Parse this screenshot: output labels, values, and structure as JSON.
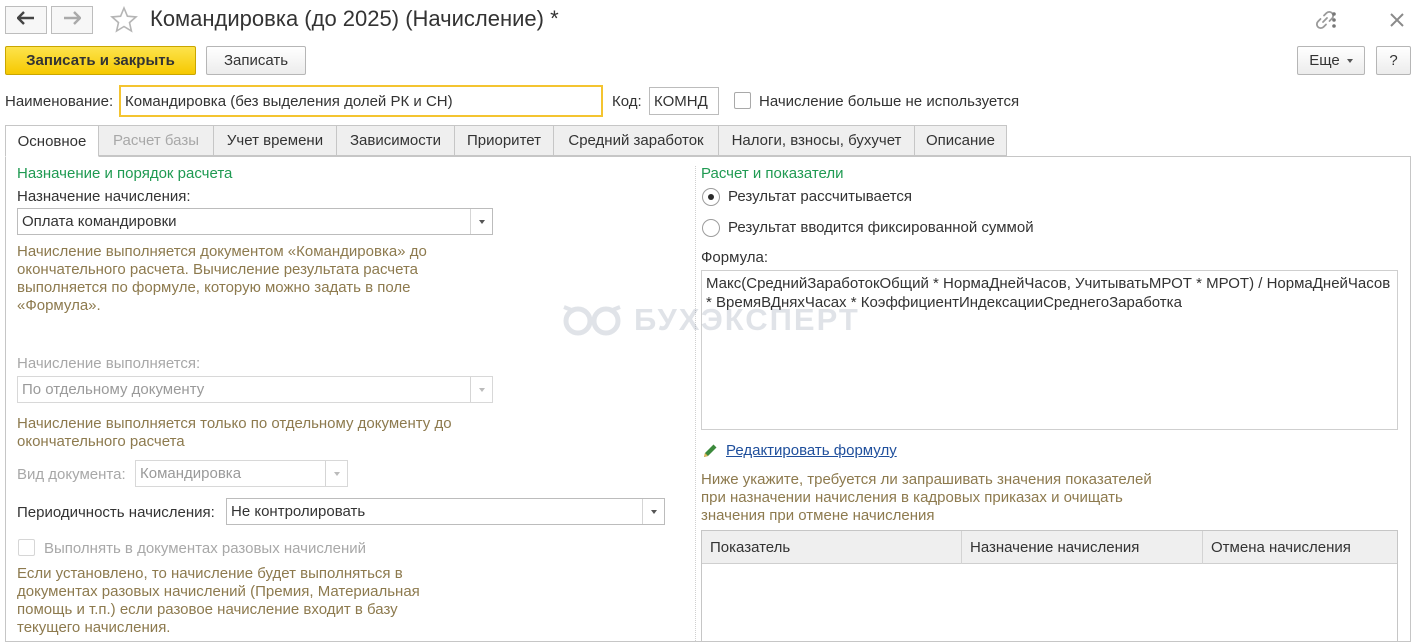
{
  "window": {
    "title": "Командировка (до 2025) (Начисление) *",
    "icons": [
      "arrow-left-icon",
      "arrow-right-icon",
      "star-icon",
      "link-icon",
      "more-vertical-icon",
      "close-icon"
    ]
  },
  "toolbar": {
    "save_close_label": "Записать и закрыть",
    "save_label": "Записать",
    "more_label": "Еще",
    "help_label": "?"
  },
  "header": {
    "name_label": "Наименование:",
    "name_value": "Командировка (без выделения долей РК и СН)",
    "code_label": "Код:",
    "code_value": "КОМНД",
    "not_used_label": "Начисление больше не используется"
  },
  "tabs": [
    {
      "label": "Основное"
    },
    {
      "label": "Расчет базы"
    },
    {
      "label": "Учет времени"
    },
    {
      "label": "Зависимости"
    },
    {
      "label": "Приоритет"
    },
    {
      "label": "Средний заработок"
    },
    {
      "label": "Налоги, взносы, бухучет"
    },
    {
      "label": "Описание"
    }
  ],
  "left": {
    "section_title": "Назначение и порядок расчета",
    "purpose_label": "Назначение начисления:",
    "purpose_value": "Оплата командировки",
    "purpose_hint": "Начисление выполняется документом «Командировка» до окончательного расчета. Вычисление результата расчета выполняется по формуле, которую можно задать в поле «Формула».",
    "performed_label": "Начисление выполняется:",
    "performed_value": "По отдельному документу",
    "performed_hint": "Начисление выполняется только по отдельному документу до окончательного расчета",
    "doc_type_label": "Вид документа:",
    "doc_type_value": "Командировка",
    "periodicity_label": "Периодичность начисления:",
    "periodicity_value": "Не контролировать",
    "one_time_label": "Выполнять в документах разовых начислений",
    "one_time_hint": "Если установлено, то начисление будет выполняться в документах разовых начислений (Премия, Материальная помощь и т.п.) если разовое начисление входит в базу текущего начисления."
  },
  "right": {
    "section_title": "Расчет и показатели",
    "radio_calculated": "Результат рассчитывается",
    "radio_fixed": "Результат вводится фиксированной суммой",
    "formula_label": "Формула:",
    "formula_value": "Макс(СреднийЗаработокОбщий * НормаДнейЧасов, УчитыватьМРОТ * МРОТ) / НормаДнейЧасов * ВремяВДняхЧасах * КоэффициентИндексацииСреднегоЗаработка",
    "edit_formula_link": "Редактировать формулу",
    "indicators_hint": "Ниже укажите, требуется ли запрашивать значения показателей при назначении начисления в кадровых приказах и очищать значения при отмене начисления",
    "grid_columns": [
      "Показатель",
      "Назначение начисления",
      "Отмена начисления"
    ]
  },
  "watermark_text": "БУХЭКСПЕРТ",
  "colors": {
    "primary_button": "#f6c900",
    "section_title": "#1f9a52",
    "hint_text": "#8d7a4e",
    "link": "#1f4f9c",
    "focus_border": "#f4c430"
  }
}
